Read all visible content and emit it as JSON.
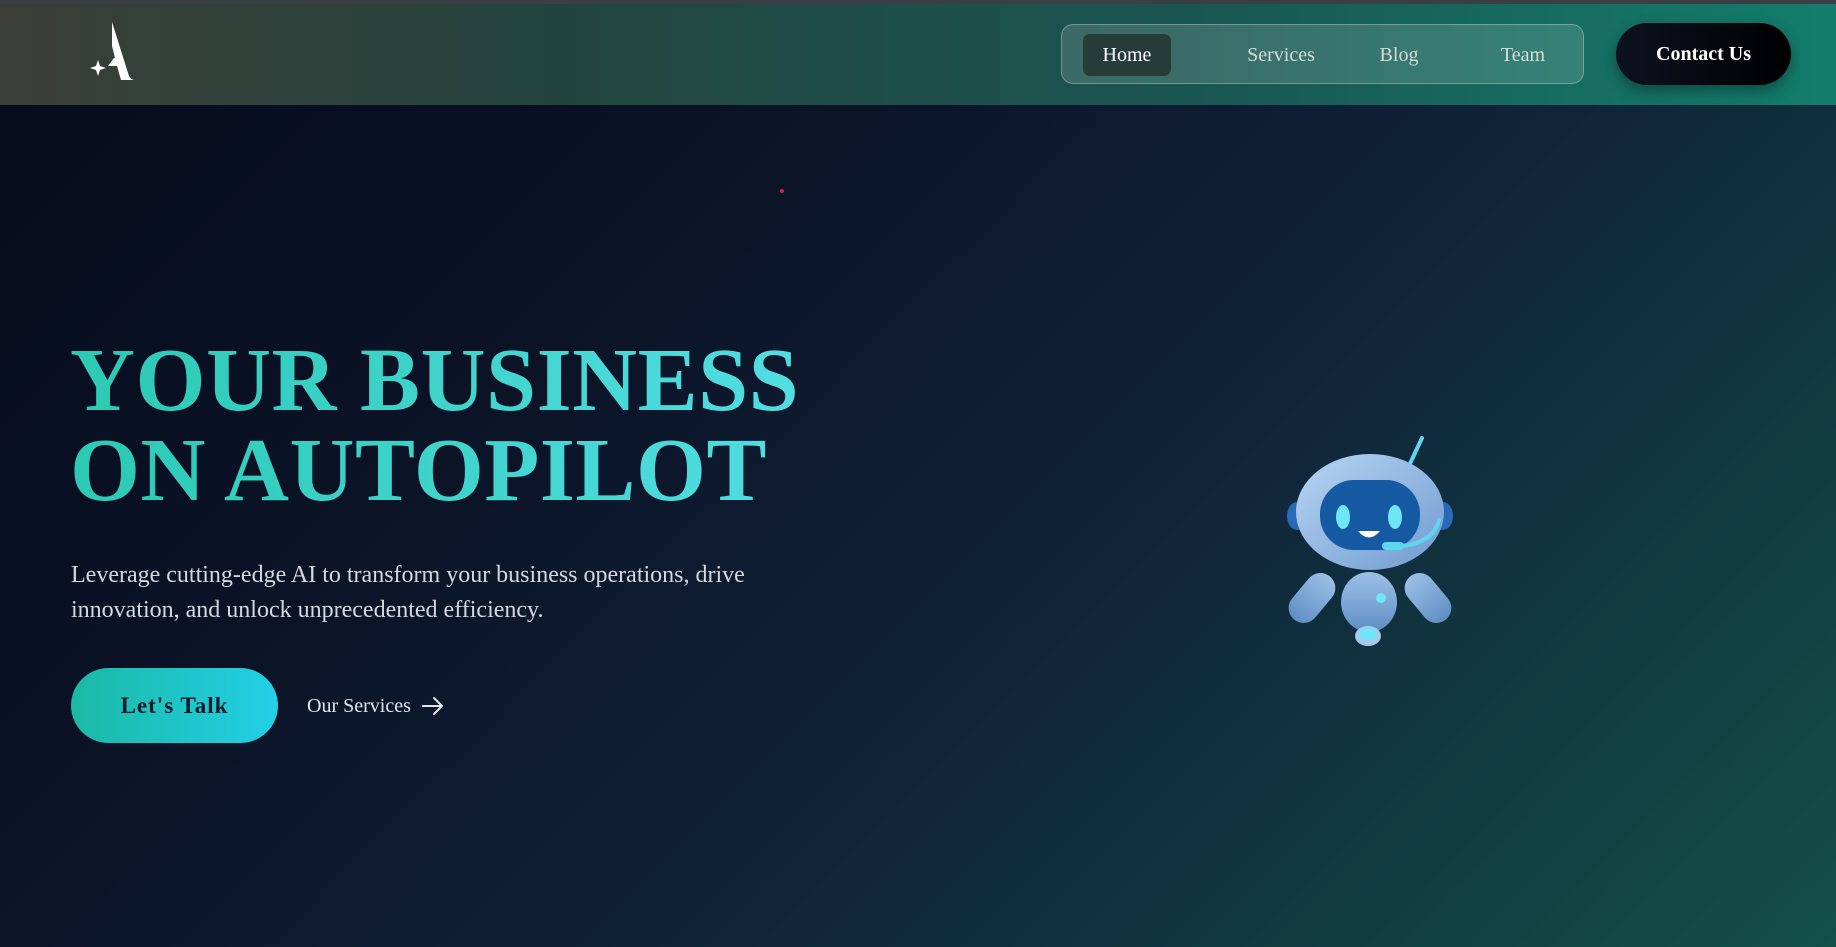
{
  "header": {
    "logo_icon": "sparkle-a-logo",
    "nav": [
      {
        "label": "Home",
        "active": true
      },
      {
        "label": "Services",
        "active": false
      },
      {
        "label": "Blog",
        "active": false
      },
      {
        "label": "Team",
        "active": false
      }
    ],
    "contact_label": "Contact Us"
  },
  "hero": {
    "title_line1": "YOUR BUSINESS",
    "title_line2": "ON AUTOPILOT",
    "subtitle": "Leverage cutting-edge AI to transform your business operations, drive innovation, and unlock unprecedented efficiency.",
    "primary_cta": "Let's Talk",
    "secondary_cta": "Our Services",
    "secondary_icon": "arrow-right-icon",
    "illustration_icon": "robot-mascot"
  },
  "colors": {
    "accent": "#2ec9b8",
    "accent_end": "#22d0e6",
    "background": "#0a1024",
    "nav_active": "#253c38",
    "contact_bg": "#000000"
  }
}
